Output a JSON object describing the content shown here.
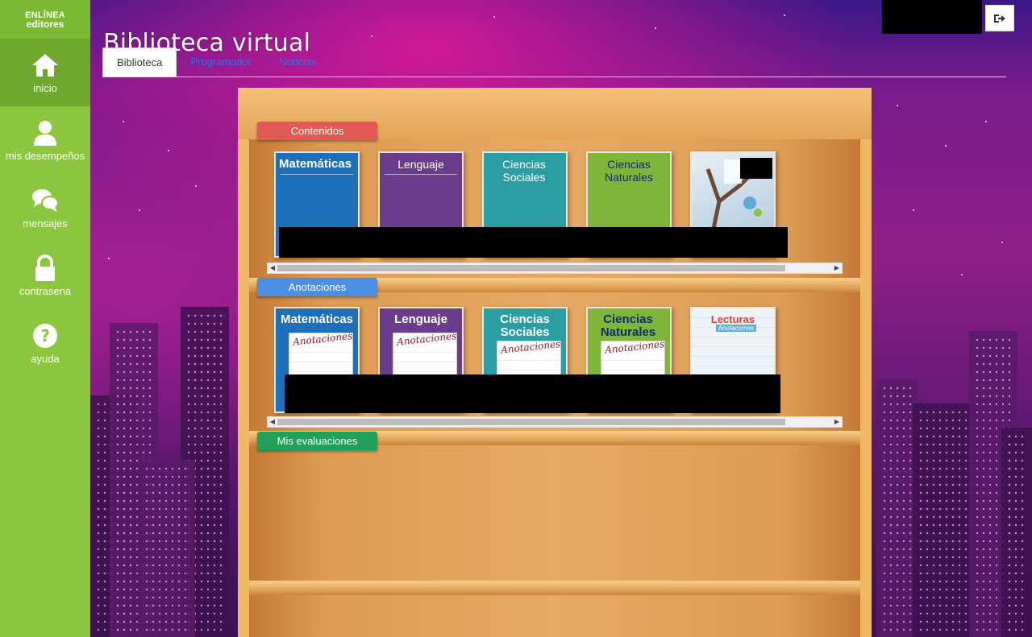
{
  "brand": {
    "line1": "ENLÍNEA",
    "line2": "editores"
  },
  "sidebar": {
    "items": [
      {
        "label": "inicio",
        "icon": "home-icon",
        "active": true
      },
      {
        "label": "mis desempeños",
        "icon": "user-icon",
        "active": false
      },
      {
        "label": "mensajes",
        "icon": "chat-icon",
        "active": false
      },
      {
        "label": "contrasena",
        "icon": "lock-icon",
        "active": false
      },
      {
        "label": "ayuda",
        "icon": "help-icon",
        "active": false
      }
    ]
  },
  "header": {
    "title": "Biblioteca virtual",
    "logout_icon": "sign-out-icon"
  },
  "tabs": [
    {
      "label": "Biblioteca",
      "active": true
    },
    {
      "label": "Programador",
      "active": false
    },
    {
      "label": "Noticias",
      "active": false
    }
  ],
  "shelves": [
    {
      "label": "Contenidos",
      "color": "#e35a55",
      "books": [
        {
          "title": "Matemáticas",
          "color": "#1d6fb8"
        },
        {
          "title": "Lenguaje",
          "color": "#6b3b8c"
        },
        {
          "title": "Ciencias Sociales",
          "color": "#2a9ea3"
        },
        {
          "title": "Ciencias Naturales",
          "color": "#7fb539"
        },
        {
          "title": "",
          "color": "#cfe2ee"
        }
      ]
    },
    {
      "label": "Anotaciones",
      "color": "#4a8fe6",
      "books": [
        {
          "title": "Matemáticas",
          "note": "Anotaciones",
          "color": "#1d6fb8"
        },
        {
          "title": "Lenguaje",
          "note": "Anotaciones",
          "color": "#6b3b8c"
        },
        {
          "title": "Ciencias Sociales",
          "note": "Anotaciones",
          "color": "#2a9ea3"
        },
        {
          "title": "Ciencias Naturales",
          "note": "Anotaciones",
          "color": "#7fb539"
        },
        {
          "title": "Lecturas",
          "note": "Anotaciones",
          "color": "#eef3f7"
        }
      ]
    },
    {
      "label": "Mis evaluaciones",
      "color": "#21a05a",
      "books": []
    }
  ]
}
